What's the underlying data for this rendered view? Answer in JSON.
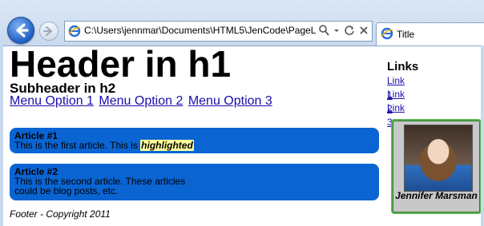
{
  "browser": {
    "address": "C:\\Users\\jennmar\\Documents\\HTML5\\JenCode\\PageL",
    "tab_title": "Title"
  },
  "page": {
    "h1": "Header in h1",
    "h2": "Subheader in h2",
    "menu": [
      "Menu Option 1",
      "Menu Option 2",
      "Menu Option 3"
    ],
    "articles": [
      {
        "title": "Article #1",
        "body": "This is the first article. This is ",
        "highlight": "highlighted"
      },
      {
        "title": "Article #2",
        "body": "This is the second article. These articles could be blog posts, etc."
      }
    ],
    "footer": "Footer - Copyright 2011",
    "links_title": "Links",
    "links": [
      "Link 1",
      "Link 2",
      "Link 3"
    ],
    "profile_name": "Jennifer Marsman"
  },
  "colors": {
    "article_bg": "#0a64d2",
    "highlight_bg": "#ffff9c",
    "profile_border": "#5db354",
    "link": "#1a0dab"
  }
}
